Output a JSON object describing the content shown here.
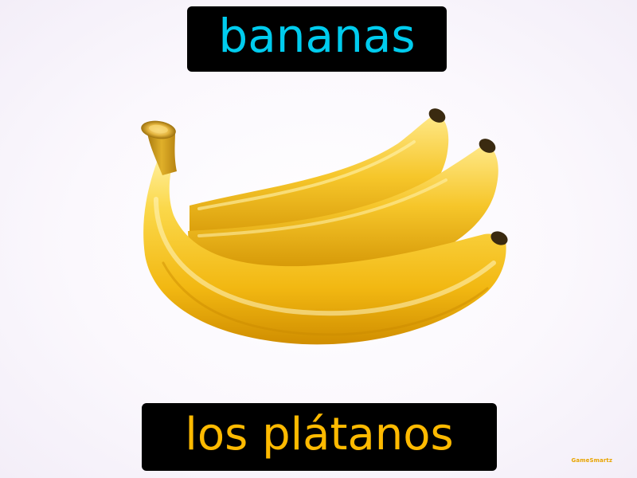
{
  "english_word": "bananas",
  "spanish_word": "los plátanos",
  "watermark": "GameSmartz",
  "image_subject": "banana-bunch",
  "colors": {
    "english_text": "#00ccee",
    "spanish_text": "#ffba00",
    "label_background": "#000000",
    "banana_yellow": "#f5c21a",
    "banana_tip": "#3a2a10"
  }
}
